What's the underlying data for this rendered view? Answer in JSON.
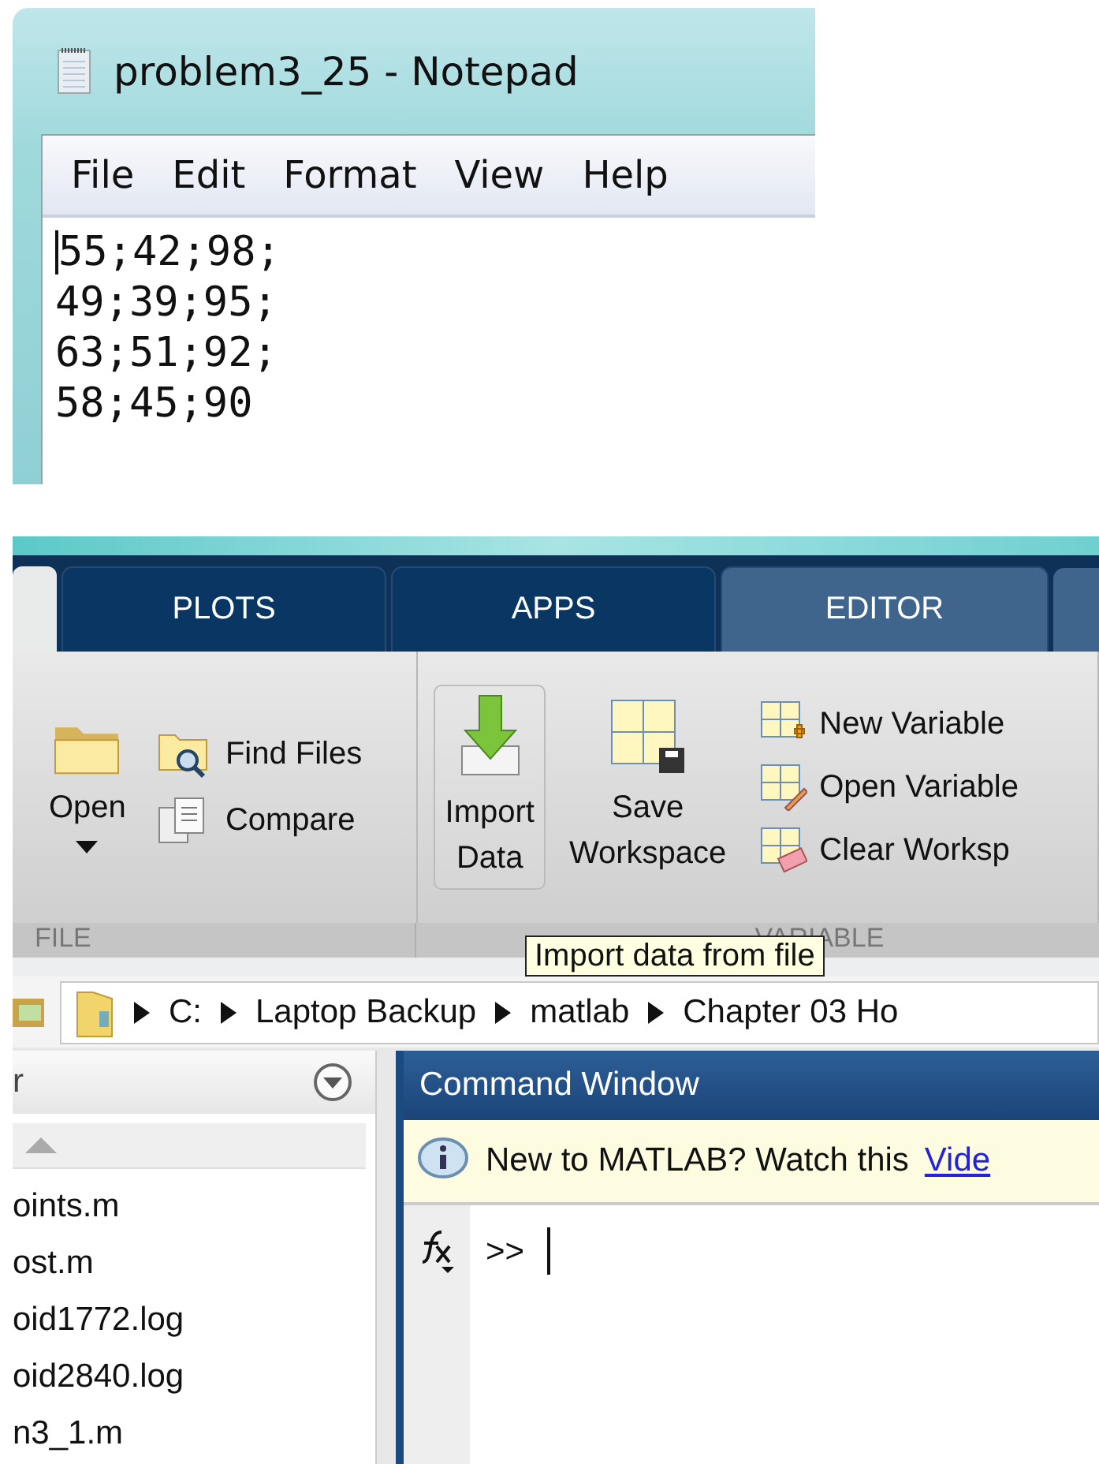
{
  "notepad": {
    "title": "problem3_25 - Notepad",
    "menu": [
      "File",
      "Edit",
      "Format",
      "View",
      "Help"
    ],
    "lines": [
      "55;42;98;",
      "49;39;95;",
      "63;51;92;",
      "58;45;90"
    ]
  },
  "matlab": {
    "tabs": [
      {
        "label": "PLOTS",
        "kind": "standard",
        "selected": false
      },
      {
        "label": "APPS",
        "kind": "standard",
        "selected": false
      },
      {
        "label": "EDITOR",
        "kind": "contextual",
        "selected": false
      }
    ],
    "ribbon": {
      "file_section": {
        "label": "FILE",
        "open": "Open",
        "small": [
          "Find Files",
          "Compare"
        ]
      },
      "variable_section": {
        "label": "VARIABLE",
        "import": {
          "label": "Import Data",
          "hovered": true
        },
        "save": "Save Workspace",
        "small": [
          "New Variable",
          "Open Variable",
          "Clear Worksp"
        ]
      }
    },
    "tooltip": "Import data from file",
    "breadcrumb": [
      "C:",
      "Laptop Backup",
      "matlab",
      "Chapter 03 Ho"
    ],
    "current_folder": {
      "title": "r",
      "files": [
        "oints.m",
        "ost.m",
        "oid1772.log",
        "oid2840.log",
        "n3_1.m"
      ]
    },
    "command_window": {
      "title": "Command Window",
      "notice": "New to MATLAB? Watch this",
      "link": "Vide",
      "prompt": ">>"
    }
  }
}
